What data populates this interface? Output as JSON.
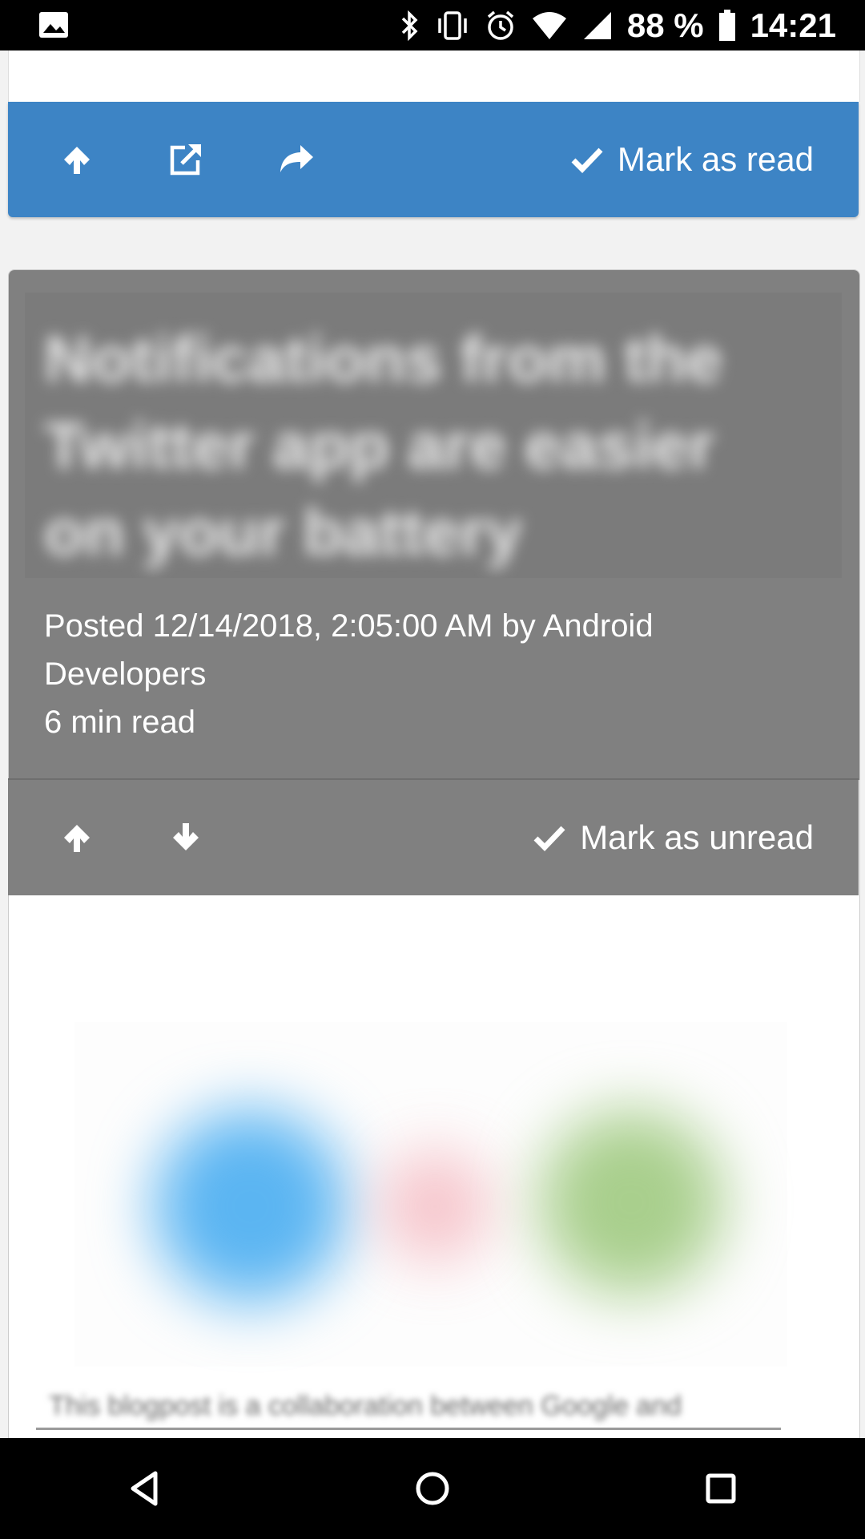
{
  "status_bar": {
    "battery_percent": "88 %",
    "time": "14:21",
    "icons": [
      "image-icon",
      "bluetooth-icon",
      "vibrate-icon",
      "alarm-icon",
      "wifi-icon",
      "signal-icon",
      "battery-icon"
    ]
  },
  "card_top": {
    "actions": [
      "arrow-up-icon",
      "external-link-icon",
      "share-icon"
    ],
    "mark_label": "Mark as read"
  },
  "card_article": {
    "title": "Notifications from the Twitter app are easier on your battery",
    "meta_posted": "Posted 12/14/2018, 2:05:00 AM by Android",
    "meta_author_cont": "Developers",
    "meta_read_time": "6 min read",
    "actions": [
      "arrow-up-icon",
      "arrow-down-icon"
    ],
    "mark_label": "Mark as unread",
    "body_first_line": "This blogpost is a collaboration between Google and"
  },
  "colors": {
    "accent_blue": "#3d84c5",
    "read_gray": "#808080"
  },
  "nav_bar": [
    "back-icon",
    "home-icon",
    "recents-icon"
  ]
}
